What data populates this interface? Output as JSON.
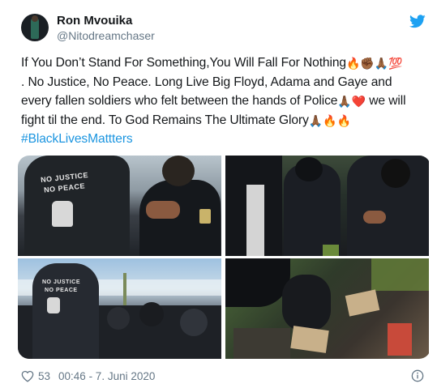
{
  "author": {
    "display_name": "Ron Mvouika",
    "handle": "@Nitodreamchaser"
  },
  "tweet": {
    "line1": "If You Don’t Stand For Something,You Will Fall For Nothing",
    "line1_emoji": "🔥✊🏾🙏🏾💯",
    "line2": ". No Justice, No Peace. Long Live Big Floyd, Adama and Gaye and",
    "line3": "every fallen soldiers who felt between the hands of Police",
    "line3_emoji": "🙏🏾❤️",
    "line3_tail": " we will",
    "line4": "fight til the end. To God Remains The Ultimate Glory",
    "line4_emoji": "🙏🏾🔥🔥",
    "hashtag": "#BlackLivesMattters"
  },
  "media": {
    "photo1_shirt": [
      "NO JUSTICE",
      "NO PEACE"
    ],
    "photo3_shirt": [
      "NO JUSTICE",
      "NO PEACE"
    ]
  },
  "footer": {
    "likes": "53",
    "timestamp": "00:46 - 7. Juni 2020"
  },
  "colors": {
    "link": "#1b95e0",
    "muted": "#657786",
    "text": "#14171a"
  },
  "icons": {
    "bird": "twitter-bird-icon",
    "heart": "heart-icon",
    "info": "info-icon"
  }
}
